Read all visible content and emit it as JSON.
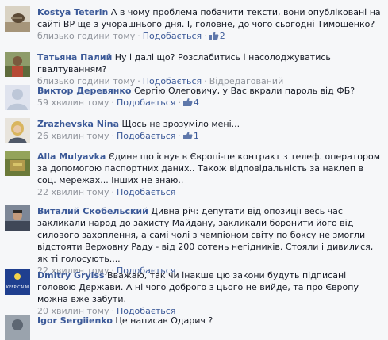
{
  "comments": [
    {
      "author": "Kostya Teterin",
      "text": "А в чому проблема побачити тексти, вони опубліковані на сайті ВР ще з учорашнього дня. І, головне, до чого сьогодні Тимошенко?",
      "time": "близько години тому",
      "action": "Подобається",
      "likes": "2",
      "avatar_icon": "avatar-photo-icon"
    },
    {
      "author": "Татьяна Палий",
      "text": "Ну і далі що? Розслабитись і насолоджуватись гвалтуванням?",
      "time": "близько години тому",
      "action": "Подобається",
      "extra_action": "Відредагований",
      "avatar_icon": "avatar-photo-icon"
    },
    {
      "author": "Виктор Деревянко",
      "text": "Сергію Олеговичу, у Вас вкрали пароль від ФБ?",
      "time": "59 хвилин тому",
      "action": "Подобається",
      "likes": "4",
      "avatar_icon": "default-avatar-icon"
    },
    {
      "author": "Zrazhevska Nina",
      "text": "Щось не зрозуміло мені...",
      "time": "26 хвилин тому",
      "action": "Подобається",
      "likes": "1",
      "avatar_icon": "avatar-photo-icon"
    },
    {
      "author": "Alla Mulyavka",
      "text": "Єдине що існує в Європі-це контракт з телеф. оператором за допомогою паспортних даних.. Також відповідальність за наклеп в соц. мережах... Інших не знаю..",
      "time": "22 хвилин тому",
      "action": "Подобається",
      "avatar_icon": "avatar-photo-icon"
    },
    {
      "author": "Виталий Скобельский",
      "text": "Дивна річ: депутати від опозиції весь час закликали народ до захисту Майдану, закликали боронити його від силового захоплення, а самі чолі з чемпіоном світу по боксу не змогли відстояти Верховну Раду - від 200 сотень негідників. Стояли і дивилися, як ті голосують....",
      "time": "22 хвилин тому",
      "action": "Подобається",
      "avatar_icon": "avatar-photo-icon"
    },
    {
      "author": "Dmitry Grylss",
      "text": "Вважаю, так чи інакше цю закони будуть підписані головою Держави. А ні чого доброго з цього не вийде, та про Європу можна вже забути.",
      "time": "20 хвилин тому",
      "action": "Подобається",
      "avatar_icon": "avatar-badge-icon",
      "avatar_text": "KEEP CALM"
    },
    {
      "author": "Igor Sergiienko",
      "text": "Це написав Одарич ?",
      "time": "",
      "action": "",
      "avatar_icon": "avatar-photo-icon"
    }
  ]
}
